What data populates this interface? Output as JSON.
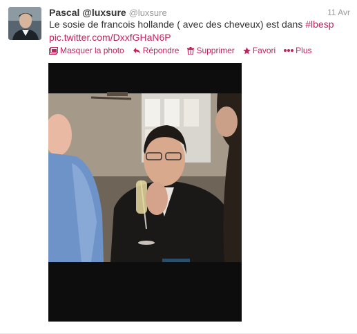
{
  "tweet": {
    "fullname": "Pascal",
    "handle_display": "@luxsure",
    "handle_secondary": "@luxsure",
    "time": "11 Avr",
    "text_main": "Le sosie de francois hollande ( avec des cheveux) est dans ",
    "hashtag": "#lbesp",
    "pic_link": "pic.twitter.com/DxxfGHaN6P"
  },
  "actions": {
    "hide_photo": "Masquer la photo",
    "reply": "Répondre",
    "delete": "Supprimer",
    "favorite": "Favori",
    "more": "Plus"
  },
  "colors": {
    "accent": "#c0245d",
    "muted": "#999999",
    "text": "#333333"
  },
  "icons": [
    "photo-icon",
    "reply-icon",
    "trash-icon",
    "star-icon",
    "more-icon"
  ]
}
